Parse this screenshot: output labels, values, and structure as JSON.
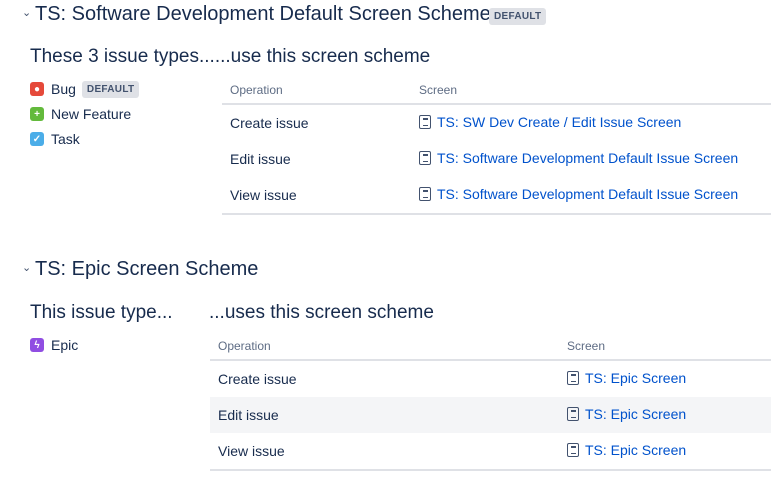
{
  "schemes": [
    {
      "title": "TS: Software Development Default Screen Scheme",
      "badge": "DEFAULT",
      "heading_left": "These 3 issue types......use this screen scheme",
      "heading_right": "",
      "issue_types": [
        {
          "name": "Bug",
          "badge": "DEFAULT",
          "color": "#e5493a"
        },
        {
          "name": "New Feature",
          "color": "#63ba3c"
        },
        {
          "name": "Task",
          "color": "#4bade8"
        }
      ],
      "columns": [
        "Operation",
        "Screen"
      ],
      "rows": [
        {
          "operation": "Create issue",
          "screen": "TS: SW Dev Create / Edit Issue Screen"
        },
        {
          "operation": "Edit issue",
          "screen": "TS: Software Development Default Issue Screen"
        },
        {
          "operation": "View issue",
          "screen": "TS: Software Development Default Issue Screen"
        }
      ]
    },
    {
      "title": "TS: Epic Screen Scheme",
      "heading_left": "This issue type...",
      "heading_right": "...uses this screen scheme",
      "issue_types": [
        {
          "name": "Epic",
          "color": "#904ee2"
        }
      ],
      "columns": [
        "Operation",
        "Screen"
      ],
      "rows": [
        {
          "operation": "Create issue",
          "screen": "TS: Epic Screen"
        },
        {
          "operation": "Edit issue",
          "screen": "TS: Epic Screen"
        },
        {
          "operation": "View issue",
          "screen": "TS: Epic Screen"
        }
      ]
    }
  ]
}
